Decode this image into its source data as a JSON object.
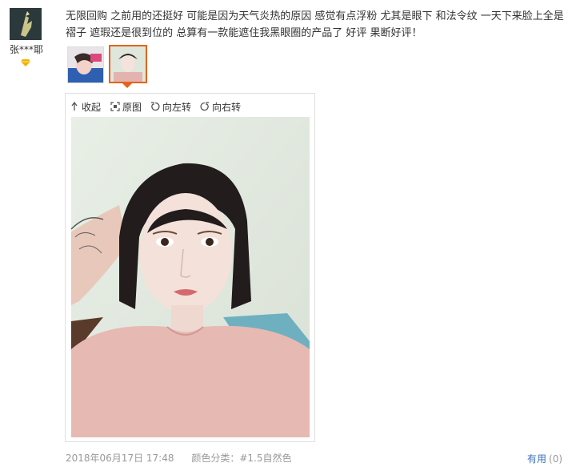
{
  "user": {
    "name": "张***耶",
    "badge_color": "#f0b400"
  },
  "review": {
    "text": "无限回购 之前用的还挺好 可能是因为天气炎热的原因 感觉有点浮粉 尤其是眼下 和法令纹 一天下来脸上全是褶子 遮瑕还是很到位的 总算有一款能遮住我黑眼圈的产品了 好评 果断好评！",
    "date": "2018年06月17日 17:48",
    "attr_label": "颜色分类：",
    "attr_value": "#1.5自然色"
  },
  "photo_toolbar": {
    "collapse_label": "收起",
    "original_label": "原图",
    "rotate_left_label": "向左转",
    "rotate_right_label": "向右转"
  },
  "thumbnails": {
    "count": 2,
    "selected_index": 1,
    "accent_color": "#e4641d"
  },
  "feedback": {
    "useful_label": "有用",
    "useful_count": "(0)",
    "link_color": "#3b6fb6"
  }
}
